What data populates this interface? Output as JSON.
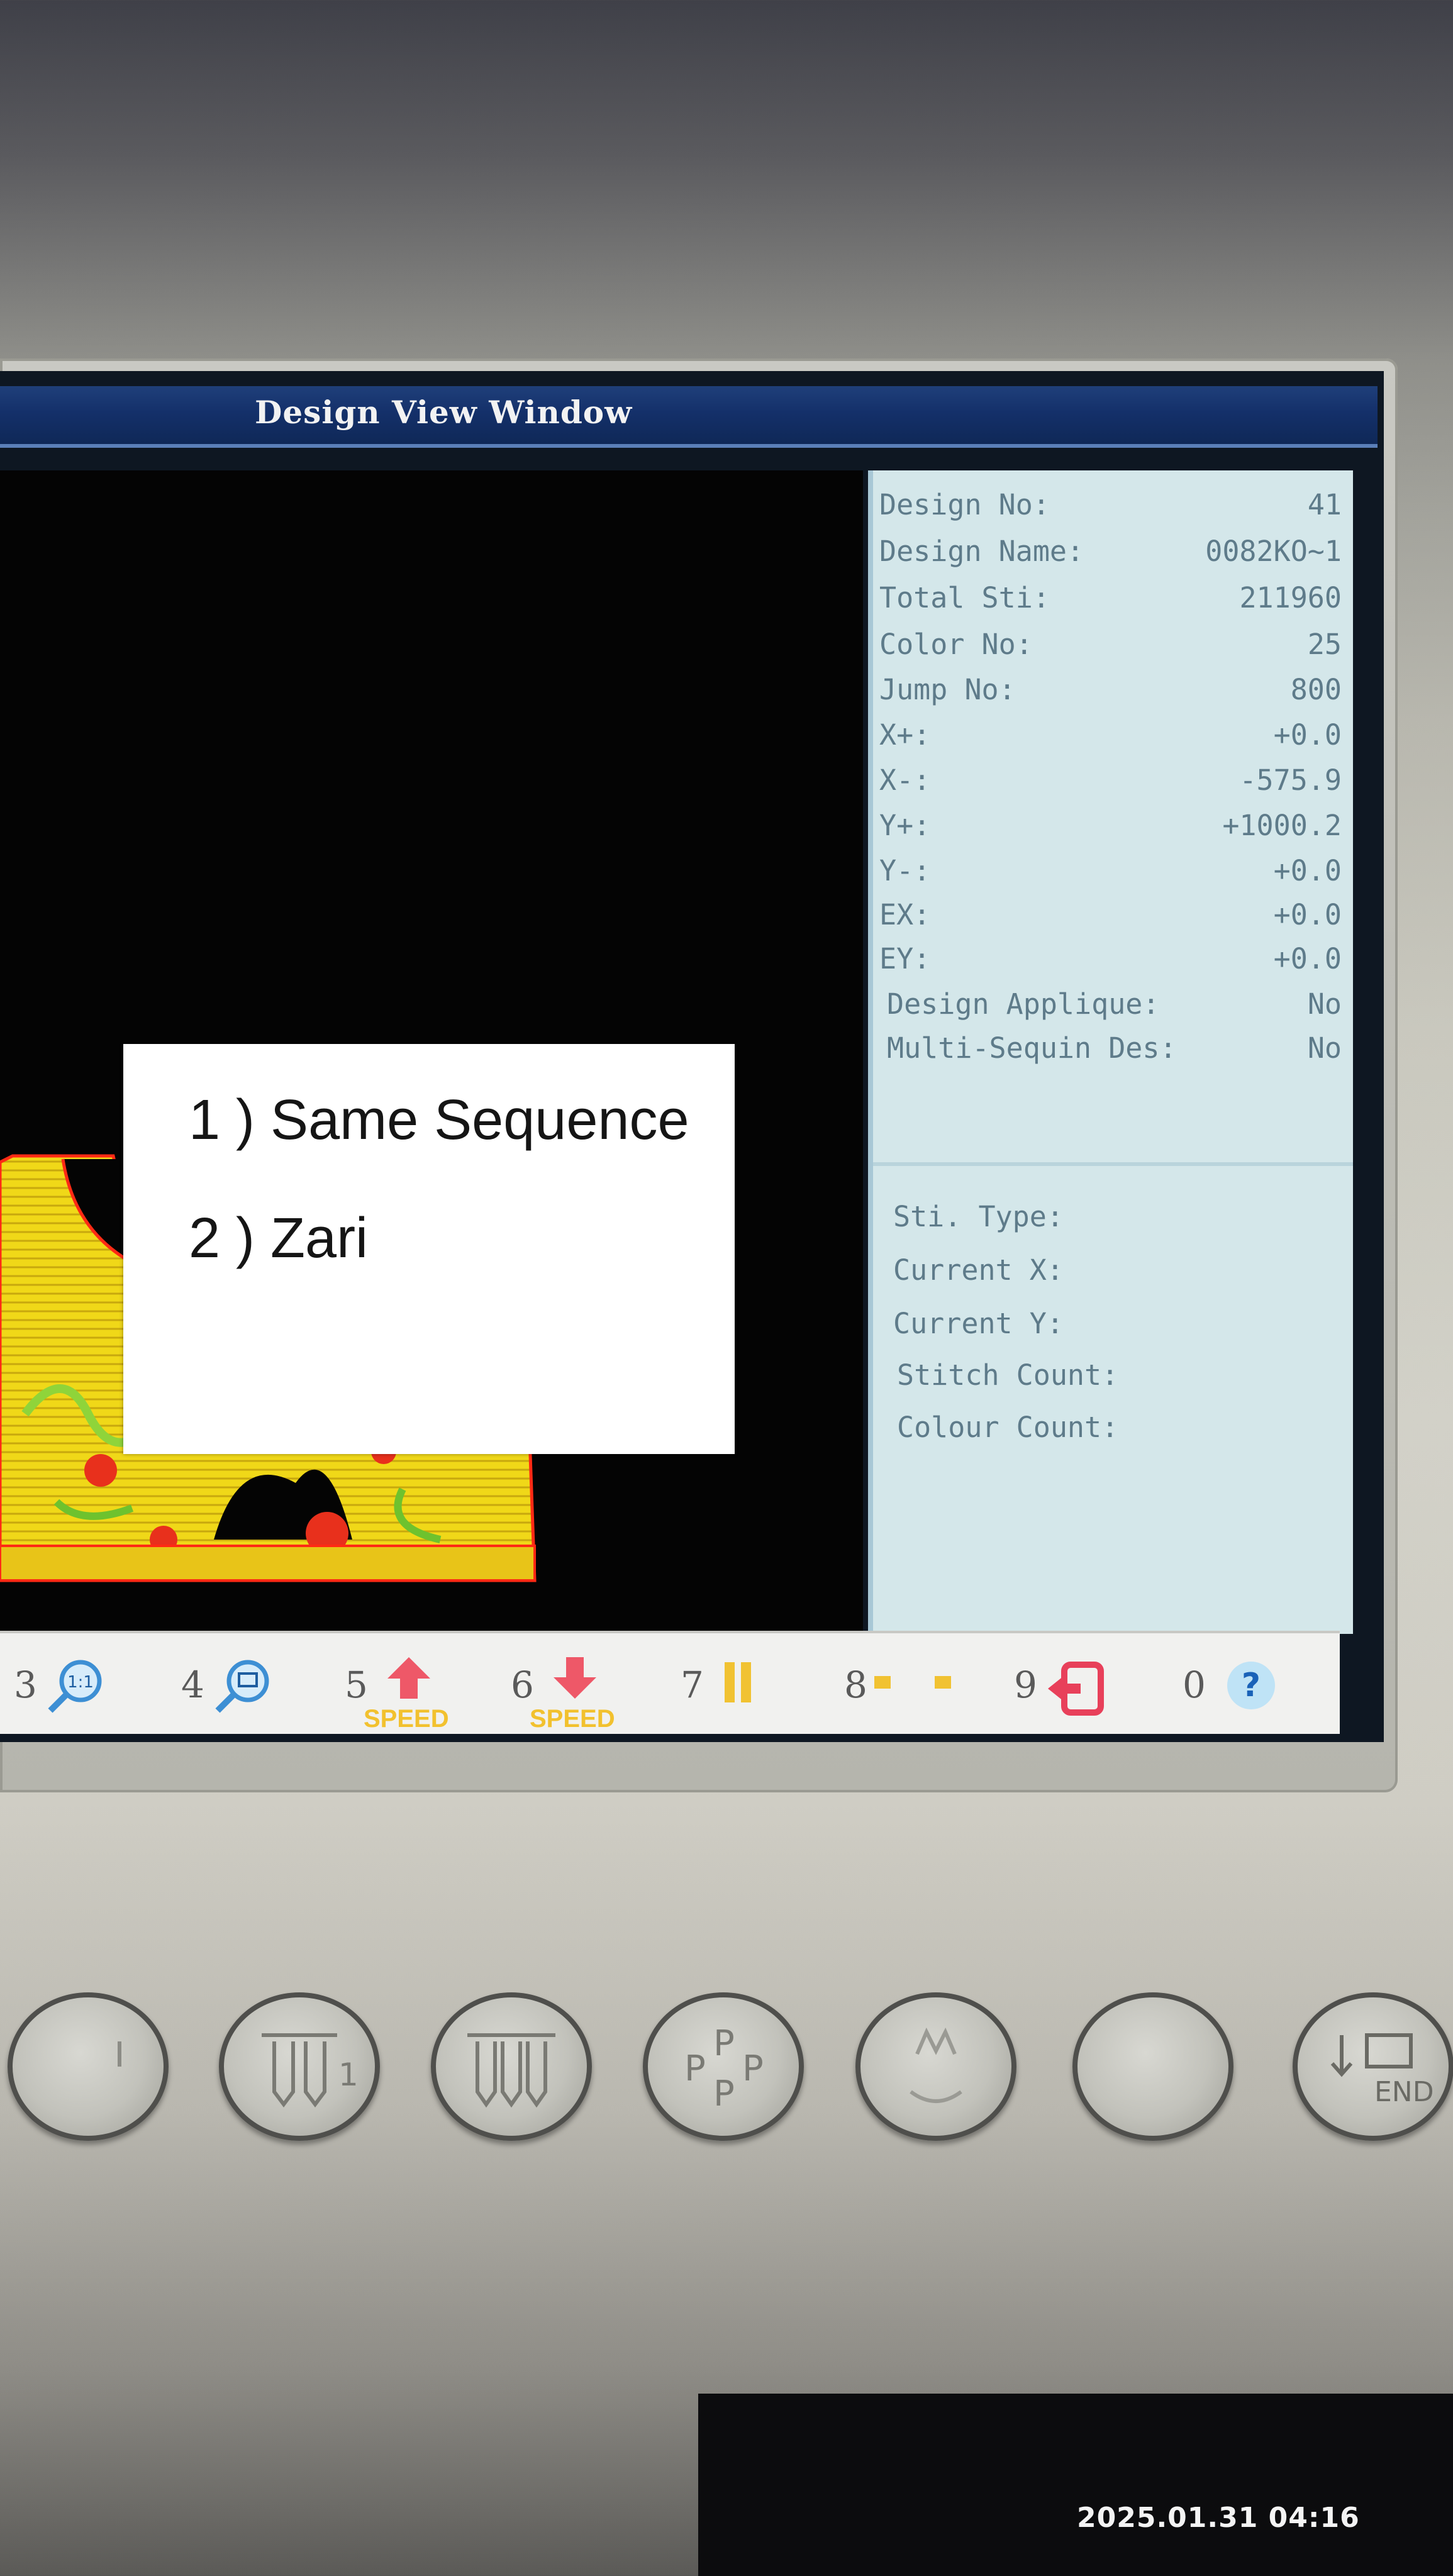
{
  "window": {
    "title": "Design View Window"
  },
  "popup": {
    "line1": "1 ) Same Sequence",
    "line2": "2 ) Zari"
  },
  "info": {
    "rows": [
      {
        "label": "Design No:",
        "value": "41"
      },
      {
        "label": "Design Name:",
        "value": "0082KO~1"
      },
      {
        "label": "Total Sti:",
        "value": "211960"
      },
      {
        "label": "Color No:",
        "value": "25"
      },
      {
        "label": "Jump No:",
        "value": "800"
      },
      {
        "label": "X+:",
        "value": "+0.0"
      },
      {
        "label": "X-:",
        "value": "-575.9"
      },
      {
        "label": "Y+:",
        "value": "+1000.2"
      },
      {
        "label": "Y-:",
        "value": "+0.0"
      },
      {
        "label": "EX:",
        "value": "+0.0"
      },
      {
        "label": "EY:",
        "value": "+0.0"
      },
      {
        "label": "Design Applique:",
        "value": "No"
      },
      {
        "label": "Multi-Sequin Des:",
        "value": "No"
      }
    ],
    "status": [
      {
        "label": "Sti. Type:"
      },
      {
        "label": "Current X:"
      },
      {
        "label": "Current Y:"
      },
      {
        "label": "Stitch Count:"
      },
      {
        "label": "Colour Count:"
      }
    ]
  },
  "fkeys": {
    "k3": "3",
    "k3_icon": "1:1",
    "k4": "4",
    "k5": "5",
    "k5_speed": "SPEED",
    "k6": "6",
    "k6_speed": "SPEED",
    "k7": "7",
    "k8": "8",
    "k9": "9",
    "k0": "0",
    "k0_icon": "?"
  },
  "buttons": {
    "end_label": "END"
  },
  "timestamp": "2025.01.31 04:16",
  "colors": {
    "titlebar": "#14306a",
    "panel": "#d4e7ea",
    "embroidery_yellow": "#f5e21b",
    "embroidery_red": "#e8301c",
    "embroidery_green": "#8fd43a"
  },
  "icons": {
    "k3": "zoom-actual-size-icon",
    "k4": "zoom-window-icon",
    "k5": "speed-up-arrow-icon",
    "k6": "speed-down-arrow-icon",
    "k7": "pause-icon",
    "k8": "frame-move-icon",
    "k9": "return-icon",
    "k0": "help-icon"
  }
}
